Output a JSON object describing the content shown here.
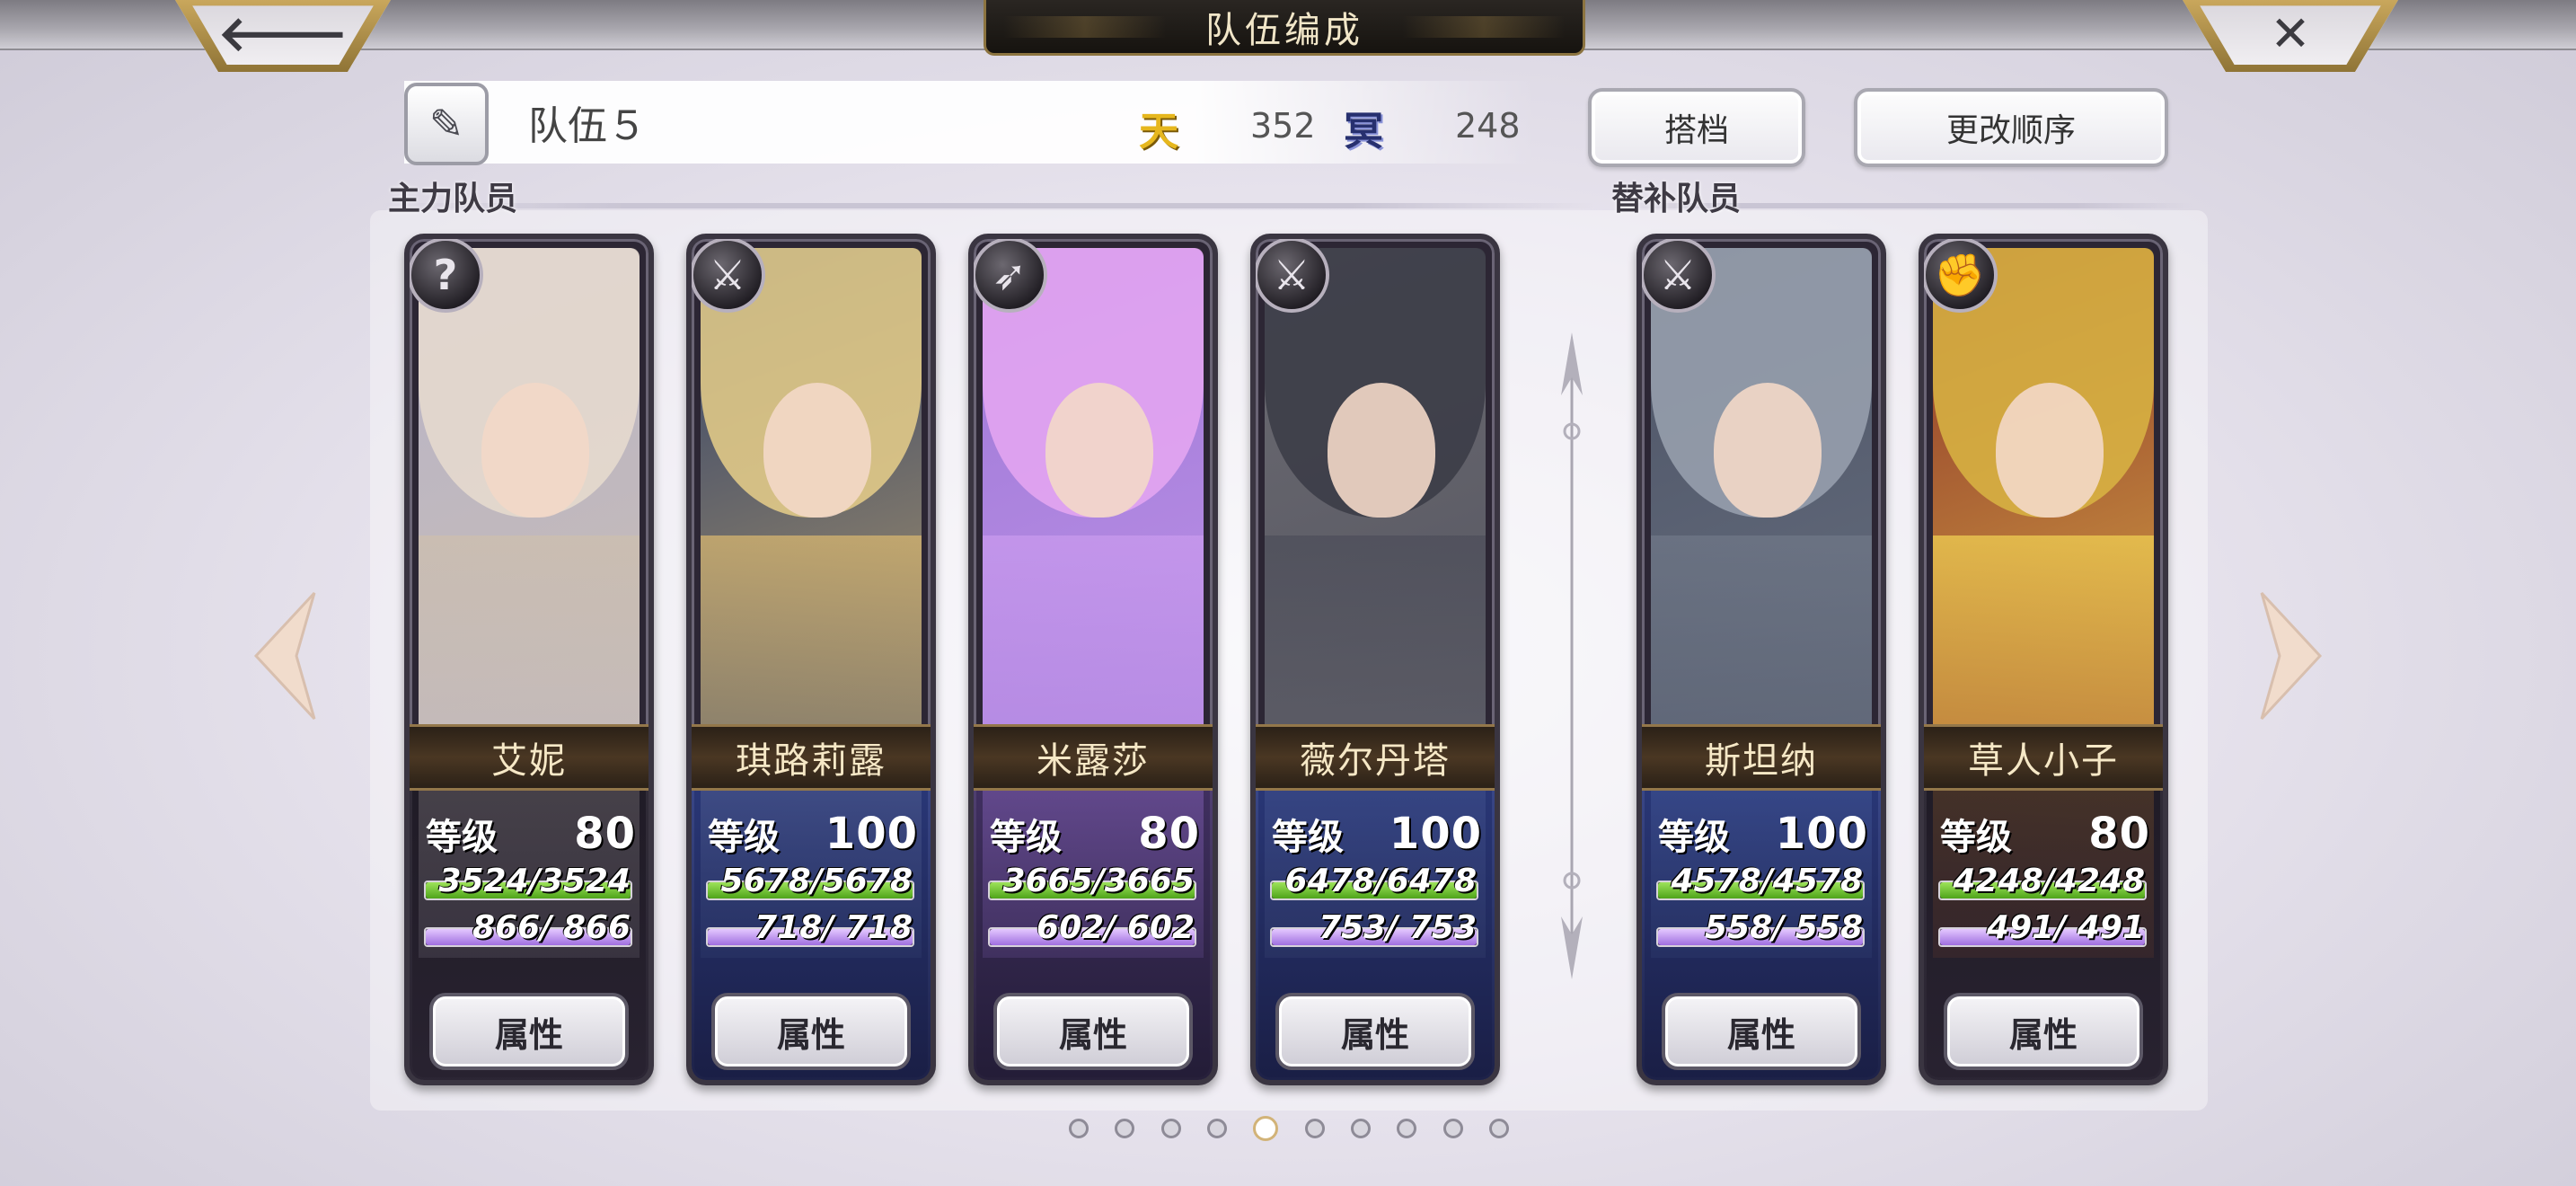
{
  "header": {
    "title": "队伍编成",
    "back_icon": "arrow-left-icon",
    "close_icon": "close-icon",
    "back_glyph": "🡐",
    "close_glyph": "✕"
  },
  "team": {
    "name": "队伍５",
    "edit_icon": "pen-icon",
    "edit_glyph": "✎",
    "sky_icon": "天",
    "sky_value": "352",
    "dark_icon": "冥",
    "dark_value": "248",
    "partner_button": "搭档",
    "order_button": "更改顺序"
  },
  "sections": {
    "main_label": "主力队员",
    "sub_label": "替补队员"
  },
  "colors": {
    "accent_gold": "#c8a85a",
    "hp_green": "#6cc42b",
    "mp_purple": "#b88af0"
  },
  "main_members": [
    {
      "name": "艾妮",
      "class_icon": "question-icon",
      "class_glyph": "?",
      "level_label": "等级",
      "level": "80",
      "hp": "3524/3524",
      "mp": "866/  866",
      "button": "属性"
    },
    {
      "name": "琪路莉露",
      "class_icon": "sword-icon",
      "class_glyph": "⚔",
      "level_label": "等级",
      "level": "100",
      "hp": "5678/5678",
      "mp": "718/  718",
      "button": "属性"
    },
    {
      "name": "米露莎",
      "class_icon": "spear-icon",
      "class_glyph": "➶",
      "level_label": "等级",
      "level": "80",
      "hp": "3665/3665",
      "mp": "602/  602",
      "button": "属性"
    },
    {
      "name": "薇尔丹塔",
      "class_icon": "sword-icon",
      "class_glyph": "⚔",
      "level_label": "等级",
      "level": "100",
      "hp": "6478/6478",
      "mp": "753/  753",
      "button": "属性"
    }
  ],
  "sub_members": [
    {
      "name": "斯坦纳",
      "class_icon": "sword-icon",
      "class_glyph": "⚔",
      "level_label": "等级",
      "level": "100",
      "hp": "4578/4578",
      "mp": "558/  558",
      "button": "属性"
    },
    {
      "name": "草人小子",
      "class_icon": "fist-icon",
      "class_glyph": "✊",
      "level_label": "等级",
      "level": "80",
      "hp": "4248/4248",
      "mp": "491/  491",
      "button": "属性"
    }
  ],
  "pagination": {
    "total": 10,
    "current": 5
  }
}
